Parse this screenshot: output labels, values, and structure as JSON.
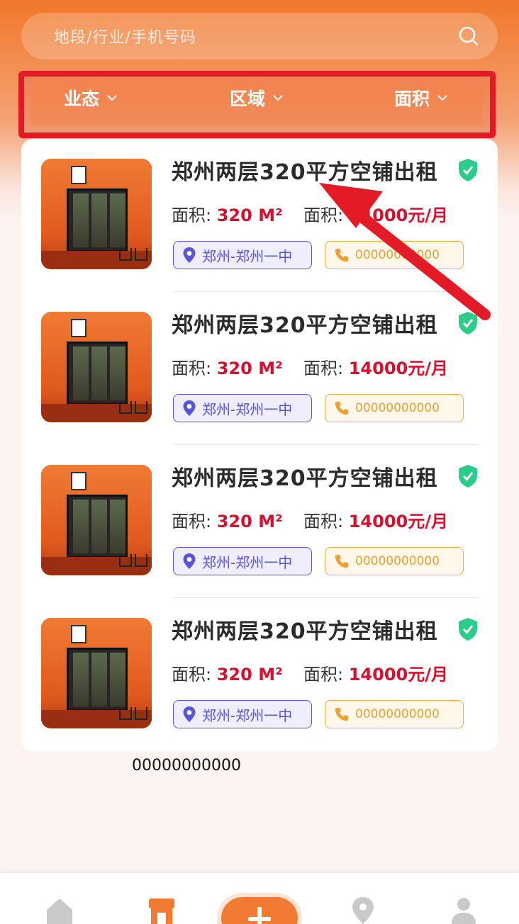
{
  "search": {
    "placeholder": "地段/行业/手机号码",
    "icon": "search-icon"
  },
  "filters": [
    {
      "label": "业态",
      "icon": "chevron-down-icon"
    },
    {
      "label": "区域",
      "icon": "chevron-down-icon"
    },
    {
      "label": "面积",
      "icon": "chevron-down-icon"
    }
  ],
  "listings": [
    {
      "title": "郑州两层320平方空铺出租",
      "area_label": "面积:",
      "area_value": "320 M²",
      "price_label": "面积:",
      "price_value": "14000元/月",
      "location": "郑州-郑州一中",
      "phone": "00000000000",
      "verified_icon": "shield-check-icon"
    },
    {
      "title": "郑州两层320平方空铺出租",
      "area_label": "面积:",
      "area_value": "320 M²",
      "price_label": "面积:",
      "price_value": "14000元/月",
      "location": "郑州-郑州一中",
      "phone": "00000000000",
      "verified_icon": "shield-check-icon"
    },
    {
      "title": "郑州两层320平方空铺出租",
      "area_label": "面积:",
      "area_value": "320 M²",
      "price_label": "面积:",
      "price_value": "14000元/月",
      "location": "郑州-郑州一中",
      "phone": "00000000000",
      "verified_icon": "shield-check-icon"
    },
    {
      "title": "郑州两层320平方空铺出租",
      "area_label": "面积:",
      "area_value": "320 M²",
      "price_label": "面积:",
      "price_value": "14000元/月",
      "location": "郑州-郑州一中",
      "phone": "00000000000",
      "verified_icon": "shield-check-icon"
    }
  ],
  "footer_number": "00000000000",
  "tabbar": {
    "items": [
      "home-icon",
      "store-icon",
      "plus-icon",
      "location-pin-icon",
      "user-icon"
    ],
    "active": "store-icon"
  },
  "colors": {
    "accent": "#f37a33",
    "price": "#d6112d",
    "location": "#5a55d8",
    "phone": "#e3a436",
    "verified": "#2ecc8a",
    "highlight": "#e31b26"
  }
}
